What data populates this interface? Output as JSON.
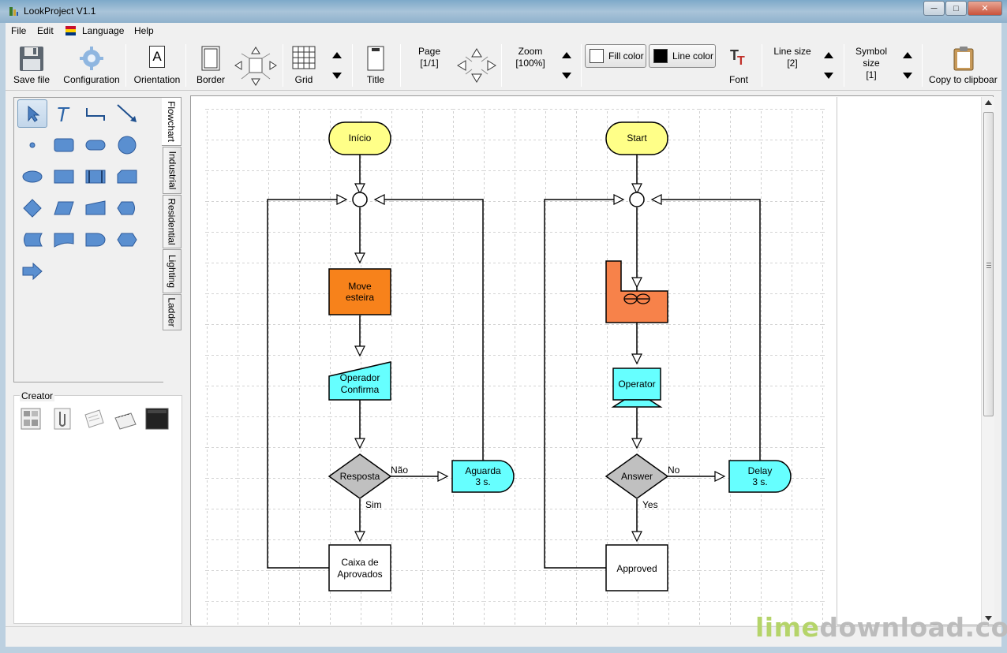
{
  "window": {
    "title": "LookProject V1.1",
    "minimize": "─",
    "maximize": "□",
    "close": "✕"
  },
  "menu": {
    "file": "File",
    "edit": "Edit",
    "language": "Language",
    "help": "Help"
  },
  "toolbar": {
    "save": "Save file",
    "configuration": "Configuration",
    "orientation": "Orientation",
    "orientation_glyph": "A",
    "border": "Border",
    "grid": "Grid",
    "title": "Title",
    "page_label": "Page",
    "page_value": "[1/1]",
    "zoom_label": "Zoom",
    "zoom_value": "[100%]",
    "fill_color": "Fill color",
    "line_color": "Line color",
    "font": "Font",
    "line_size_label": "Line size",
    "line_size_value": "[2]",
    "symbol_size_label1": "Symbol",
    "symbol_size_label2": "size",
    "symbol_size_value": "[1]",
    "copy": "Copy to clipboar",
    "fill_swatch": "#ffffff",
    "line_swatch": "#000000"
  },
  "tabs": [
    "Flowchart",
    "Industrial",
    "Residential",
    "Lighting",
    "Ladder"
  ],
  "creator": {
    "title": "Creator"
  },
  "flow_left": {
    "start": "Início",
    "process": [
      "Move",
      "esteira"
    ],
    "input": [
      "Operador",
      "Confirma"
    ],
    "decision": "Resposta",
    "no": "Não",
    "yes": "Sim",
    "delay": [
      "Aguarda",
      "3 s."
    ],
    "end": [
      "Caixa de",
      "Aprovados"
    ]
  },
  "flow_right": {
    "start": "Start",
    "operator": "Operator",
    "decision": "Answer",
    "no": "No",
    "yes": "Yes",
    "delay": [
      "Delay",
      "3 s."
    ],
    "end": "Approved"
  },
  "colors": {
    "terminal": "#ffff88",
    "process": "#f7821b",
    "input": "#66ffff",
    "decision": "#c0c0c0",
    "delay": "#66ffff",
    "tank": "#f7824a"
  },
  "watermark": {
    "lime": "lime",
    "rest": "download.com"
  }
}
